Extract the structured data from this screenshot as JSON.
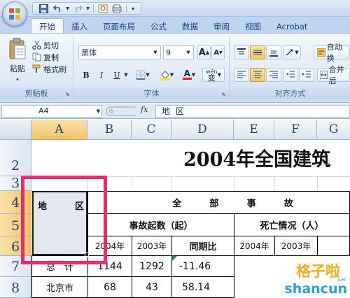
{
  "app": {
    "accent": "#15428b",
    "highlight_color": "#ea2c6d"
  },
  "quick_access": {
    "icons": [
      "save-icon",
      "undo-icon",
      "redo-icon",
      "preview-icon",
      "customize-icon"
    ]
  },
  "ribbon_tabs": [
    "开始",
    "插入",
    "页面布局",
    "公式",
    "数据",
    "审阅",
    "视图",
    "Acrobat"
  ],
  "clipboard": {
    "paste_label": "粘贴",
    "cut_label": "剪切",
    "copy_label": "复制",
    "format_painter_label": "格式刷",
    "group_label": "剪贴板"
  },
  "font": {
    "name": "黑体",
    "size": "9",
    "grow_label": "A",
    "shrink_label": "A",
    "bold_label": "B",
    "italic_label": "I",
    "underline_label": "U",
    "font_color_label": "A",
    "phonetic_label": "wén",
    "phonetic_sub": "变",
    "group_label": "字体"
  },
  "alignment": {
    "wrap_label": "自动换",
    "merge_label": "合并后",
    "group_label": "对齐方式"
  },
  "formula_bar": {
    "name_box": "A4",
    "fx_label": "fx",
    "formula": "地区"
  },
  "sheet": {
    "columns": [
      "A",
      "B",
      "C",
      "D",
      "E",
      "F",
      "G"
    ],
    "selected_column": "A",
    "rows": [
      "2",
      "3",
      "4",
      "5",
      "6",
      "7",
      "8"
    ],
    "selected_rows": [
      "4",
      "5",
      "6"
    ],
    "title": "2004年全国建筑",
    "a4_left": "地",
    "a4_right": "区",
    "row4_header": [
      "全",
      "部",
      "事",
      "故"
    ],
    "row5_accidents": "事故起数（起）",
    "row5_deaths": "死亡情况（人）",
    "row6": [
      "2004年",
      "2003年",
      "同期比",
      "2004年",
      "2003年"
    ],
    "row7": [
      "总　计",
      "1144",
      "1292",
      "-11.46"
    ],
    "row8": [
      "北京市",
      "68",
      "43",
      "58.14"
    ]
  },
  "watermark": {
    "top": "格子啦",
    "bottom": "shancun",
    "small": ".net"
  }
}
